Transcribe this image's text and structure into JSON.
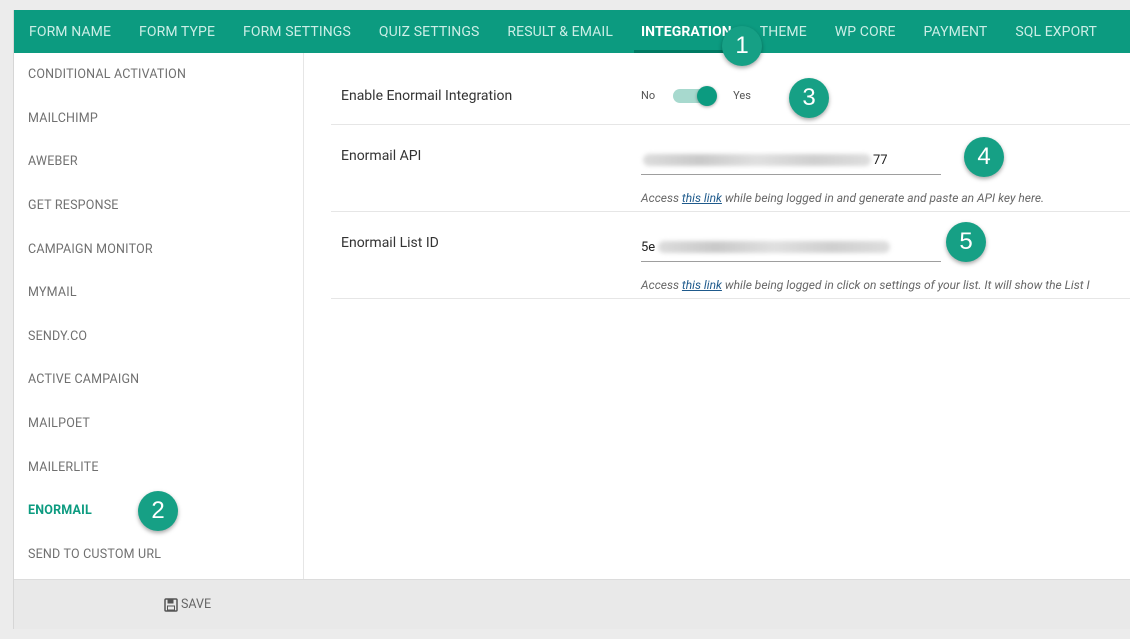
{
  "tabs": [
    {
      "label": "FORM NAME"
    },
    {
      "label": "FORM TYPE"
    },
    {
      "label": "FORM SETTINGS"
    },
    {
      "label": "QUIZ SETTINGS"
    },
    {
      "label": "RESULT & EMAIL"
    },
    {
      "label": "INTEGRATION",
      "active": true
    },
    {
      "label": "THEME"
    },
    {
      "label": "WP CORE"
    },
    {
      "label": "PAYMENT"
    },
    {
      "label": "SQL EXPORT"
    }
  ],
  "sidebar": {
    "items": [
      {
        "label": "CONDITIONAL ACTIVATION"
      },
      {
        "label": "MAILCHIMP"
      },
      {
        "label": "AWEBER"
      },
      {
        "label": "GET RESPONSE"
      },
      {
        "label": "CAMPAIGN MONITOR"
      },
      {
        "label": "MYMAIL"
      },
      {
        "label": "SENDY.CO"
      },
      {
        "label": "ACTIVE CAMPAIGN"
      },
      {
        "label": "MAILPOET"
      },
      {
        "label": "MAILERLITE"
      },
      {
        "label": "ENORMAIL",
        "active": true
      },
      {
        "label": "SEND TO CUSTOM URL"
      }
    ]
  },
  "settings": {
    "enable": {
      "label": "Enable Enormail Integration",
      "off_label": "No",
      "on_label": "Yes",
      "value": true
    },
    "api": {
      "label": "Enormail API",
      "value_visible": "77",
      "hint_before": "Access ",
      "hint_link": "this link",
      "hint_after": " while being logged in and generate and paste an API key here."
    },
    "list_id": {
      "label": "Enormail List ID",
      "value_visible": "5e",
      "hint_before": "Access ",
      "hint_link": "this link",
      "hint_after": " while being logged in click on settings of your list. It will show the List I"
    }
  },
  "footer": {
    "save_label": "SAVE"
  },
  "badges": [
    {
      "number": "1"
    },
    {
      "number": "2"
    },
    {
      "number": "3"
    },
    {
      "number": "4"
    },
    {
      "number": "5"
    }
  ],
  "colors": {
    "accent": "#0c9b80",
    "badge": "#16a085"
  },
  "icons": {
    "save": "floppy-disk-icon"
  }
}
